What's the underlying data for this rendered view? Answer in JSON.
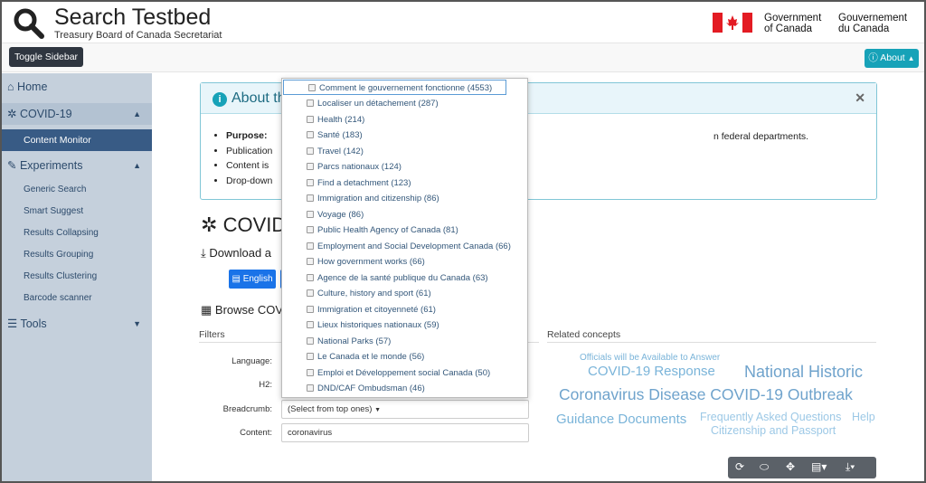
{
  "header": {
    "title": "Search Testbed",
    "subtitle": "Treasury Board of Canada Secretariat",
    "gov_en_1": "Government",
    "gov_en_2": "of Canada",
    "gov_fr_1": "Gouvernement",
    "gov_fr_2": "du Canada"
  },
  "navbar": {
    "toggle_label": "Toggle Sidebar",
    "about_label": "About"
  },
  "sidebar": {
    "home": "Home",
    "covid": "COVID-19",
    "content_monitor": "Content Monitor",
    "experiments": "Experiments",
    "experiment_items": [
      "Generic Search",
      "Smart Suggest",
      "Results Collapsing",
      "Results Grouping",
      "Results Clustering",
      "Barcode scanner"
    ],
    "tools": "Tools"
  },
  "about_panel": {
    "title": "About th",
    "bullet1_bold": "Purpose:",
    "bullet2": "Publication",
    "bullet3": "Content is",
    "bullet4": "Drop-down",
    "bullet1_tail": "n federal departments."
  },
  "main": {
    "covid_title": "COVID",
    "download_title": "Download a",
    "english_button": "English",
    "browse_title": "Browse COV",
    "filters_heading": "Filters",
    "related_heading": "Related concepts"
  },
  "filters": {
    "language_label": "Language:",
    "h2_label": "H2:",
    "breadcrumb_label": "Breadcrumb:",
    "breadcrumb_value": "(Select from top ones)",
    "content_label": "Content:",
    "content_value": "coronavirus"
  },
  "dropdown_items": [
    "Comment le gouvernement fonctionne (4553)",
    "Localiser un détachement (287)",
    "Health (214)",
    "Santé (183)",
    "Travel (142)",
    "Parcs nationaux (124)",
    "Find a detachment (123)",
    "Immigration and citizenship (86)",
    "Voyage (86)",
    "Public Health Agency of Canada (81)",
    "Employment and Social Development Canada (66)",
    "How government works (66)",
    "Agence de la santé publique du Canada (63)",
    "Culture, history and sport (61)",
    "Immigration et citoyenneté (61)",
    "Lieux historiques nationaux (59)",
    "National Parks (57)",
    "Le Canada et le monde (56)",
    "Emploi et Développement social Canada (50)",
    "DND/CAF Ombudsman (46)"
  ],
  "related_concepts": [
    "Officials will be Available to Answer",
    "COVID-19 Response",
    "National Historic",
    "Coronavirus Disease COVID-19 Outbreak",
    "Guidance Documents",
    "Frequently Asked Questions",
    "Help",
    "Citizenship and Passport"
  ],
  "colors": {
    "sidebar_bg": "#c5d0dc",
    "active_item": "#385b85",
    "accent": "#17a2b8",
    "button_blue": "#1a73e8"
  },
  "icons": [
    "search-logo-icon",
    "canada-flag-icon",
    "info-icon",
    "home-icon",
    "cog-icon",
    "wrench-icon",
    "list-icon",
    "download-icon",
    "grid-icon",
    "refresh-icon",
    "toggle-icon",
    "move-icon",
    "table-icon"
  ]
}
